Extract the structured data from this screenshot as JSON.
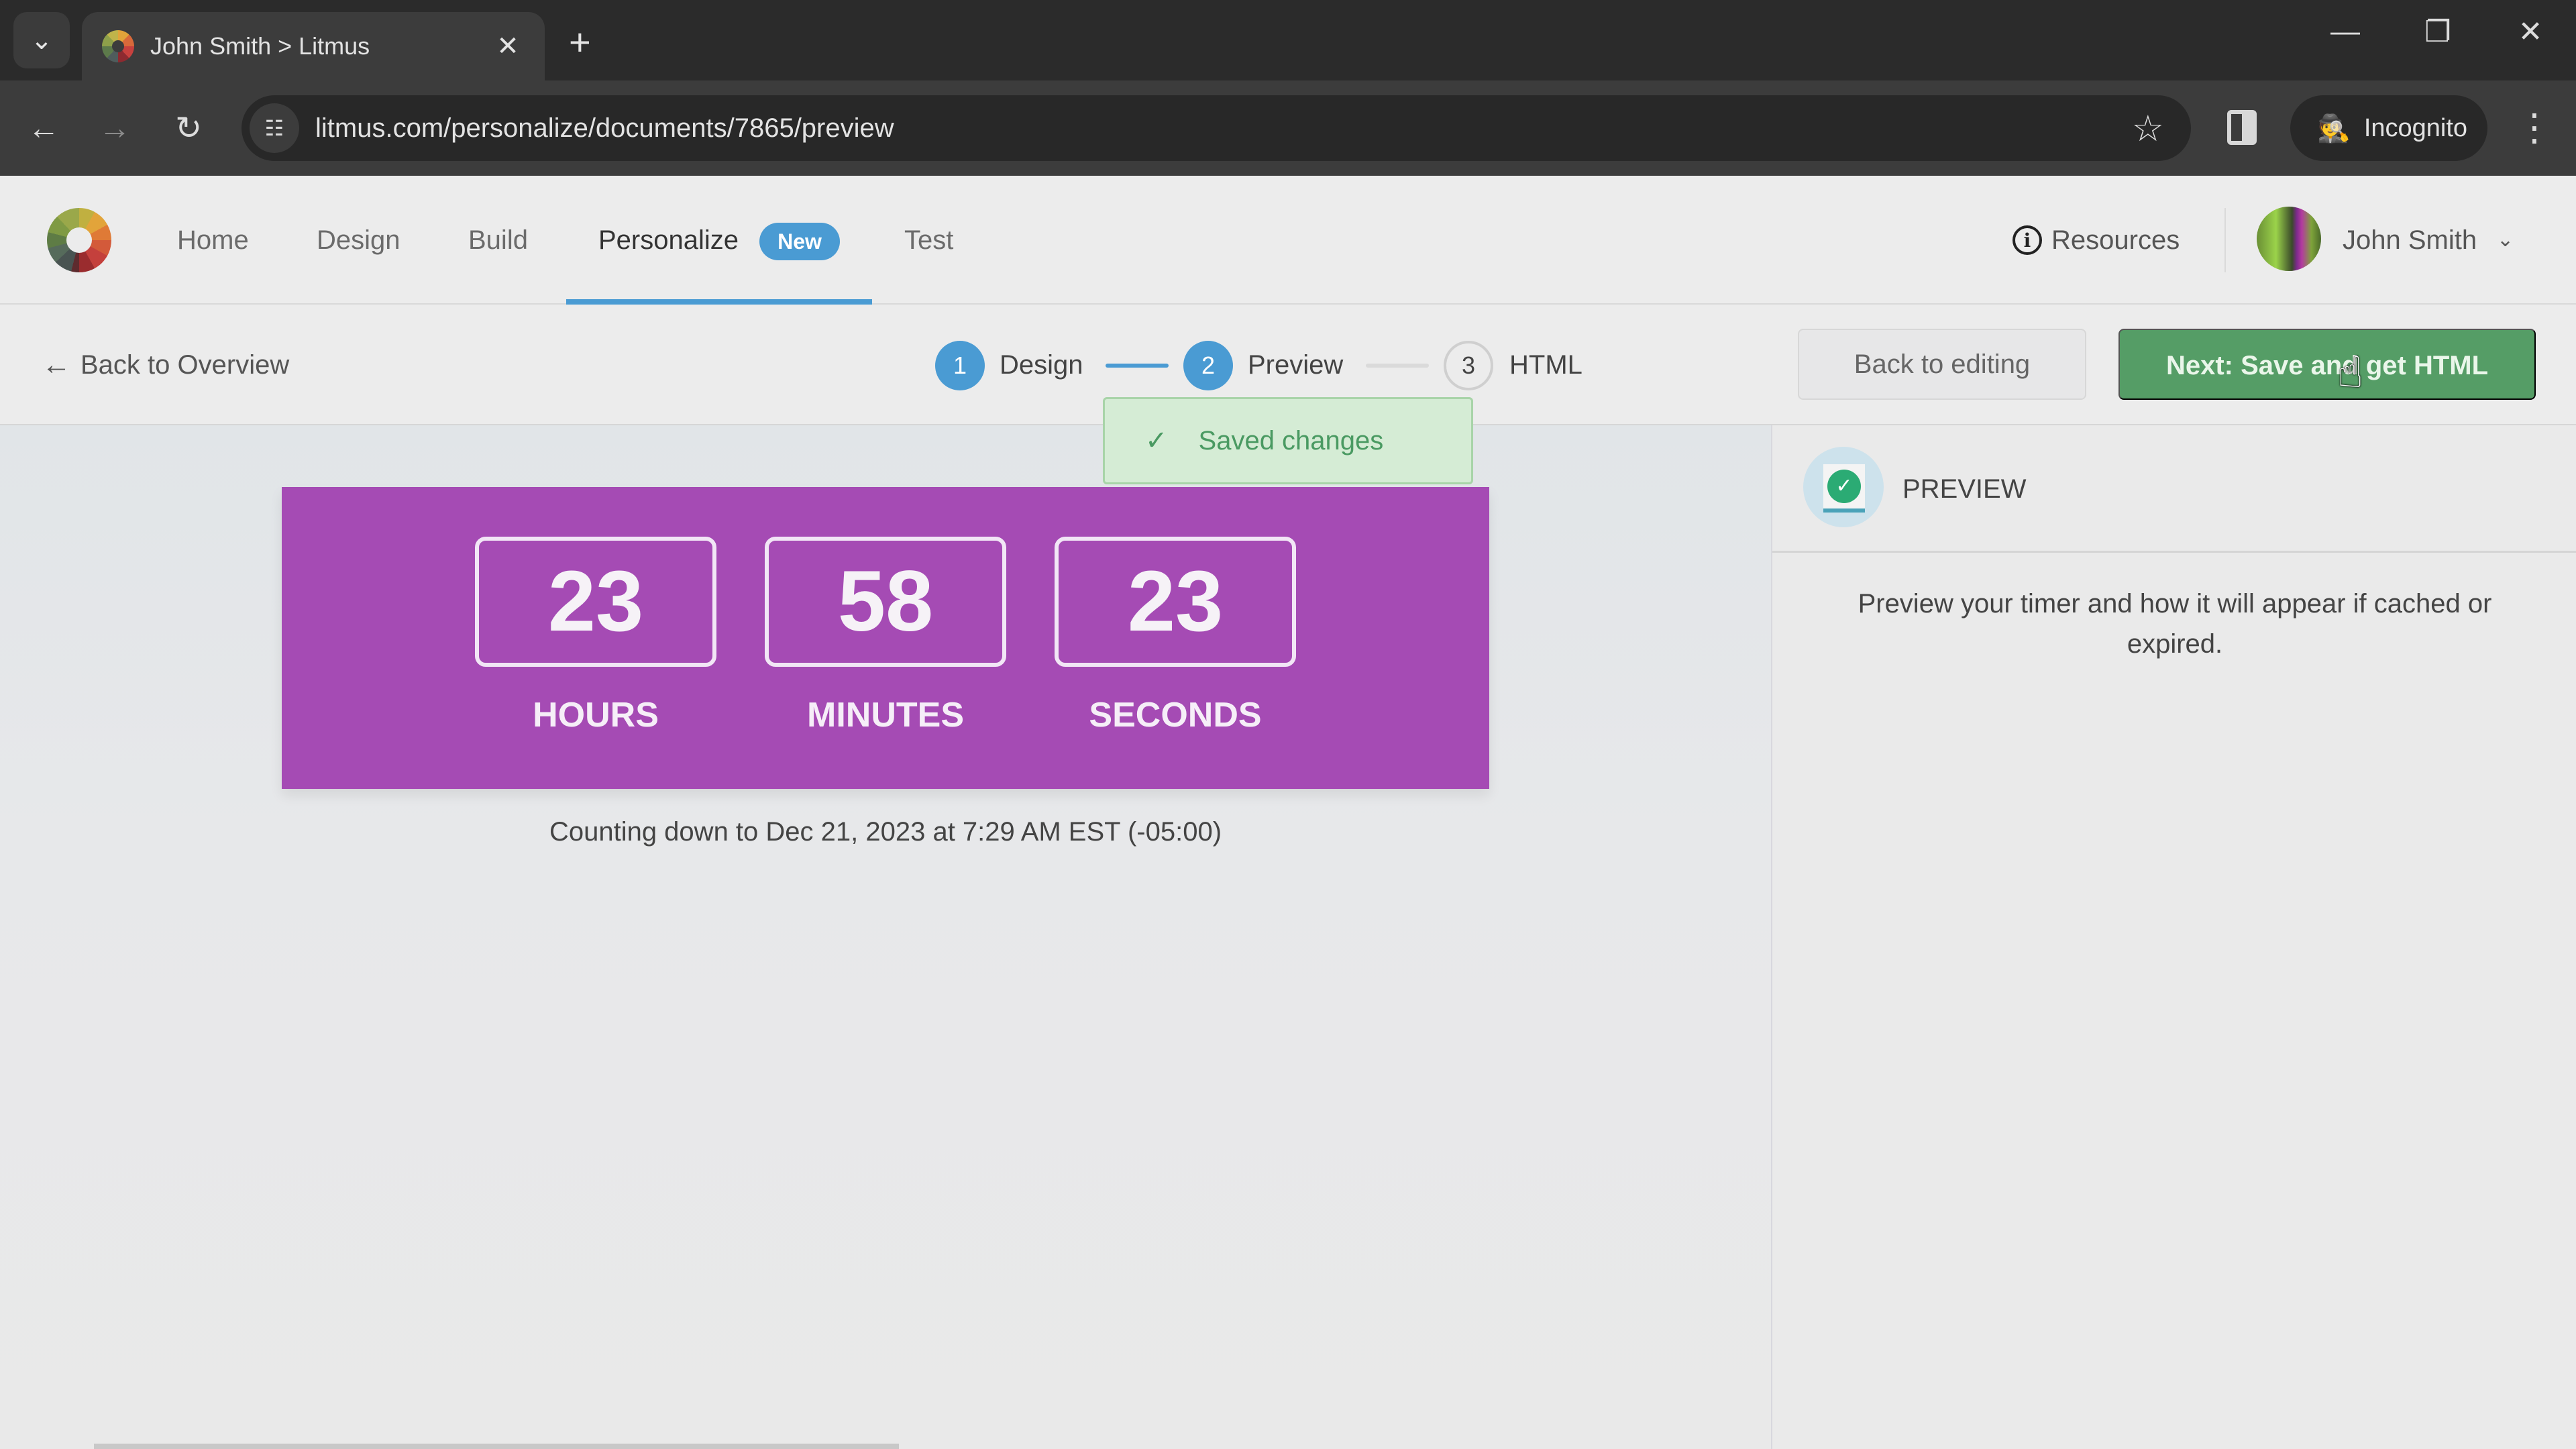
{
  "browser": {
    "tab_title": "John Smith > Litmus",
    "url": "litmus.com/personalize/documents/7865/preview",
    "incognito_label": "Incognito",
    "icons": {
      "tab_search": "chevron-down-icon",
      "tab_close": "close-icon",
      "new_tab": "plus-icon",
      "minimize": "minimize-icon",
      "restore": "restore-icon",
      "close": "close-icon",
      "back": "arrow-left-icon",
      "forward": "arrow-right-icon",
      "reload": "reload-icon",
      "site_info": "tune-icon",
      "bookmark": "star-icon",
      "side_panel": "side-panel-icon",
      "incognito": "incognito-icon",
      "menu": "kebab-menu-icon"
    },
    "glyphs": {
      "tab_search": "⌄",
      "tab_close": "✕",
      "new_tab": "+",
      "minimize": "—",
      "restore": "❐",
      "close": "✕",
      "back": "←",
      "forward": "→",
      "reload": "↻",
      "site_info": "☷",
      "bookmark": "☆",
      "incognito": "🕵",
      "menu": "⋮"
    }
  },
  "header": {
    "nav": [
      {
        "label": "Home"
      },
      {
        "label": "Design"
      },
      {
        "label": "Build"
      },
      {
        "label": "Personalize",
        "active": true,
        "badge": "New"
      },
      {
        "label": "Test"
      }
    ],
    "resources_label": "Resources",
    "resources_icon_glyph": "i",
    "user_name": "John Smith",
    "user_chevron": "⌄"
  },
  "steps_bar": {
    "back_label": "Back to Overview",
    "back_glyph": "←",
    "steps": [
      {
        "number": "1",
        "label": "Design",
        "state": "complete"
      },
      {
        "number": "2",
        "label": "Preview",
        "state": "current"
      },
      {
        "number": "3",
        "label": "HTML",
        "state": "upcoming"
      }
    ],
    "back_to_editing_label": "Back to editing",
    "next_label": "Next: Save and get HTML"
  },
  "toast": {
    "check_glyph": "✓",
    "message": "Saved changes"
  },
  "timer": {
    "background_color": "#a54bb4",
    "units": [
      {
        "value": "23",
        "label": "HOURS"
      },
      {
        "value": "58",
        "label": "MINUTES"
      },
      {
        "value": "23",
        "label": "SECONDS"
      }
    ],
    "caption": "Counting down to Dec 21, 2023 at 7:29 AM EST (-05:00)"
  },
  "panel": {
    "title": "PREVIEW",
    "check_glyph": "✓",
    "description": "Preview your timer and how it will appear if cached or expired."
  },
  "colors": {
    "accent_blue": "#4a9bd3",
    "primary_green": "#559d66",
    "toast_bg": "#d5ecd5",
    "toast_text": "#4a9a62",
    "timer_purple": "#a54bb4"
  }
}
